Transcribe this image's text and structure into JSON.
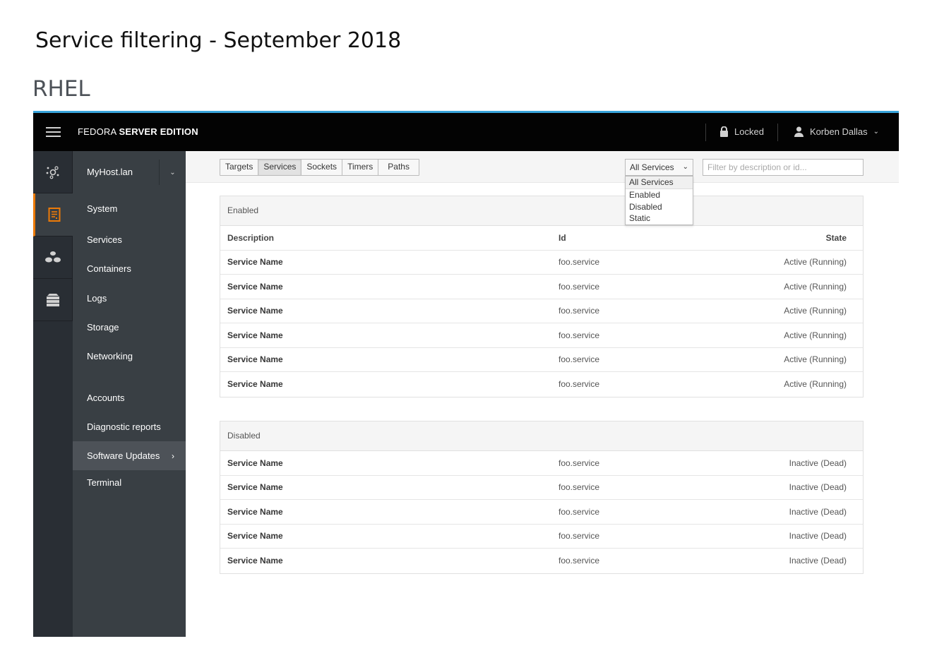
{
  "page": {
    "title": "Service filtering - September 2018",
    "section": "RHEL"
  },
  "topbar": {
    "brand_light": "FEDORA",
    "brand_bold": "SERVER EDITION",
    "locked_label": "Locked",
    "user_label": "Korben Dallas",
    "accent_color": "#39a5dc"
  },
  "iconbar": {
    "items": [
      {
        "icon": "network-icon"
      },
      {
        "icon": "document-icon",
        "active": true
      },
      {
        "icon": "containers-icon"
      },
      {
        "icon": "server-icon"
      }
    ],
    "active_color": "#ec7a08"
  },
  "nav": {
    "host": "MyHost.lan",
    "items": [
      {
        "label": "System"
      },
      {
        "label": "Services"
      },
      {
        "label": "Containers"
      },
      {
        "label": "Logs"
      },
      {
        "label": "Storage"
      },
      {
        "label": "Networking"
      },
      {
        "label": "Accounts"
      },
      {
        "label": "Diagnostic reports"
      },
      {
        "label": "Software Updates",
        "arrow": "›"
      },
      {
        "label": "Terminal"
      }
    ]
  },
  "toolbar": {
    "tabs": [
      "Targets",
      "Services",
      "Sockets",
      "Timers",
      "Paths"
    ],
    "active_tab": "Services",
    "select_value": "All Services",
    "select_options": [
      "All Services",
      "Enabled",
      "Disabled",
      "Static"
    ],
    "filter_placeholder": "Filter by description or id..."
  },
  "enabled_panel": {
    "title": "Enabled",
    "columns": [
      "Description",
      "Id",
      "State"
    ],
    "rows": [
      [
        "Service Name",
        "foo.service",
        "Active (Running)"
      ],
      [
        "Service Name",
        "foo.service",
        "Active (Running)"
      ],
      [
        "Service Name",
        "foo.service",
        "Active (Running)"
      ],
      [
        "Service Name",
        "foo.service",
        "Active (Running)"
      ],
      [
        "Service Name",
        "foo.service",
        "Active (Running)"
      ],
      [
        "Service Name",
        "foo.service",
        "Active (Running)"
      ]
    ]
  },
  "disabled_panel": {
    "title": "Disabled",
    "rows": [
      [
        "Service Name",
        "foo.service",
        "Inactive (Dead)"
      ],
      [
        "Service Name",
        "foo.service",
        "Inactive (Dead)"
      ],
      [
        "Service Name",
        "foo.service",
        "Inactive (Dead)"
      ],
      [
        "Service Name",
        "foo.service",
        "Inactive (Dead)"
      ],
      [
        "Service Name",
        "foo.service",
        "Inactive (Dead)"
      ]
    ]
  }
}
